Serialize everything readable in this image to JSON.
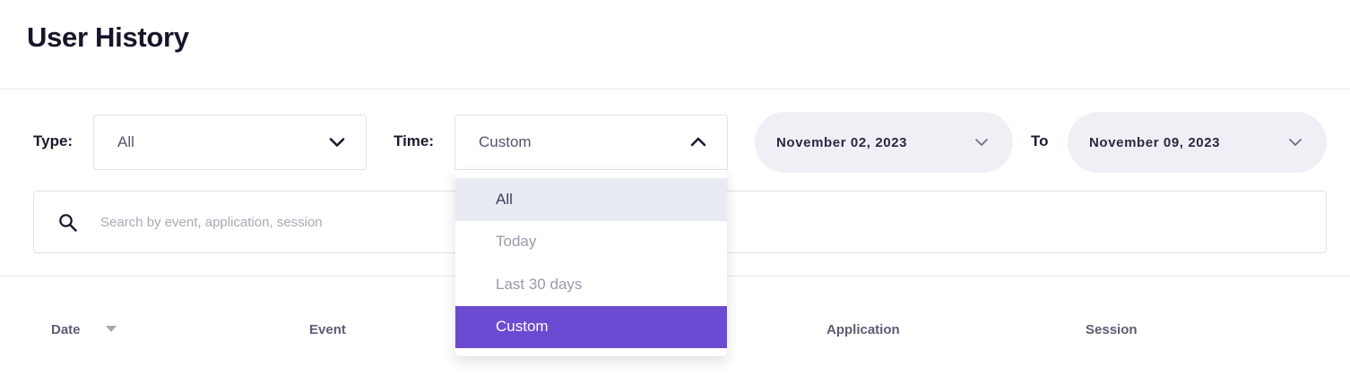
{
  "page": {
    "title": "User History"
  },
  "filters": {
    "type_label": "Type:",
    "type_value": "All",
    "time_label": "Time:",
    "time_value": "Custom",
    "time_options": [
      "All",
      "Today",
      "Last 30 days",
      "Custom"
    ],
    "time_hovered_option": "All",
    "time_selected_option": "Custom",
    "date_from": "November 02, 2023",
    "to_label": "To",
    "date_to": "November 09, 2023"
  },
  "search": {
    "placeholder": "Search by event, application, session"
  },
  "table": {
    "columns": [
      "Date",
      "Event",
      "Application",
      "Session"
    ],
    "sort_column": "Date",
    "sort_direction": "descending"
  },
  "colors": {
    "accent": "#6b4bd1",
    "pill_background": "#eef0f6",
    "hover_background": "#e9ebf3",
    "divider": "#e6e6ec"
  },
  "icons": [
    "chevron-down-icon",
    "chevron-up-icon",
    "search-icon",
    "sort-caret-icon"
  ]
}
